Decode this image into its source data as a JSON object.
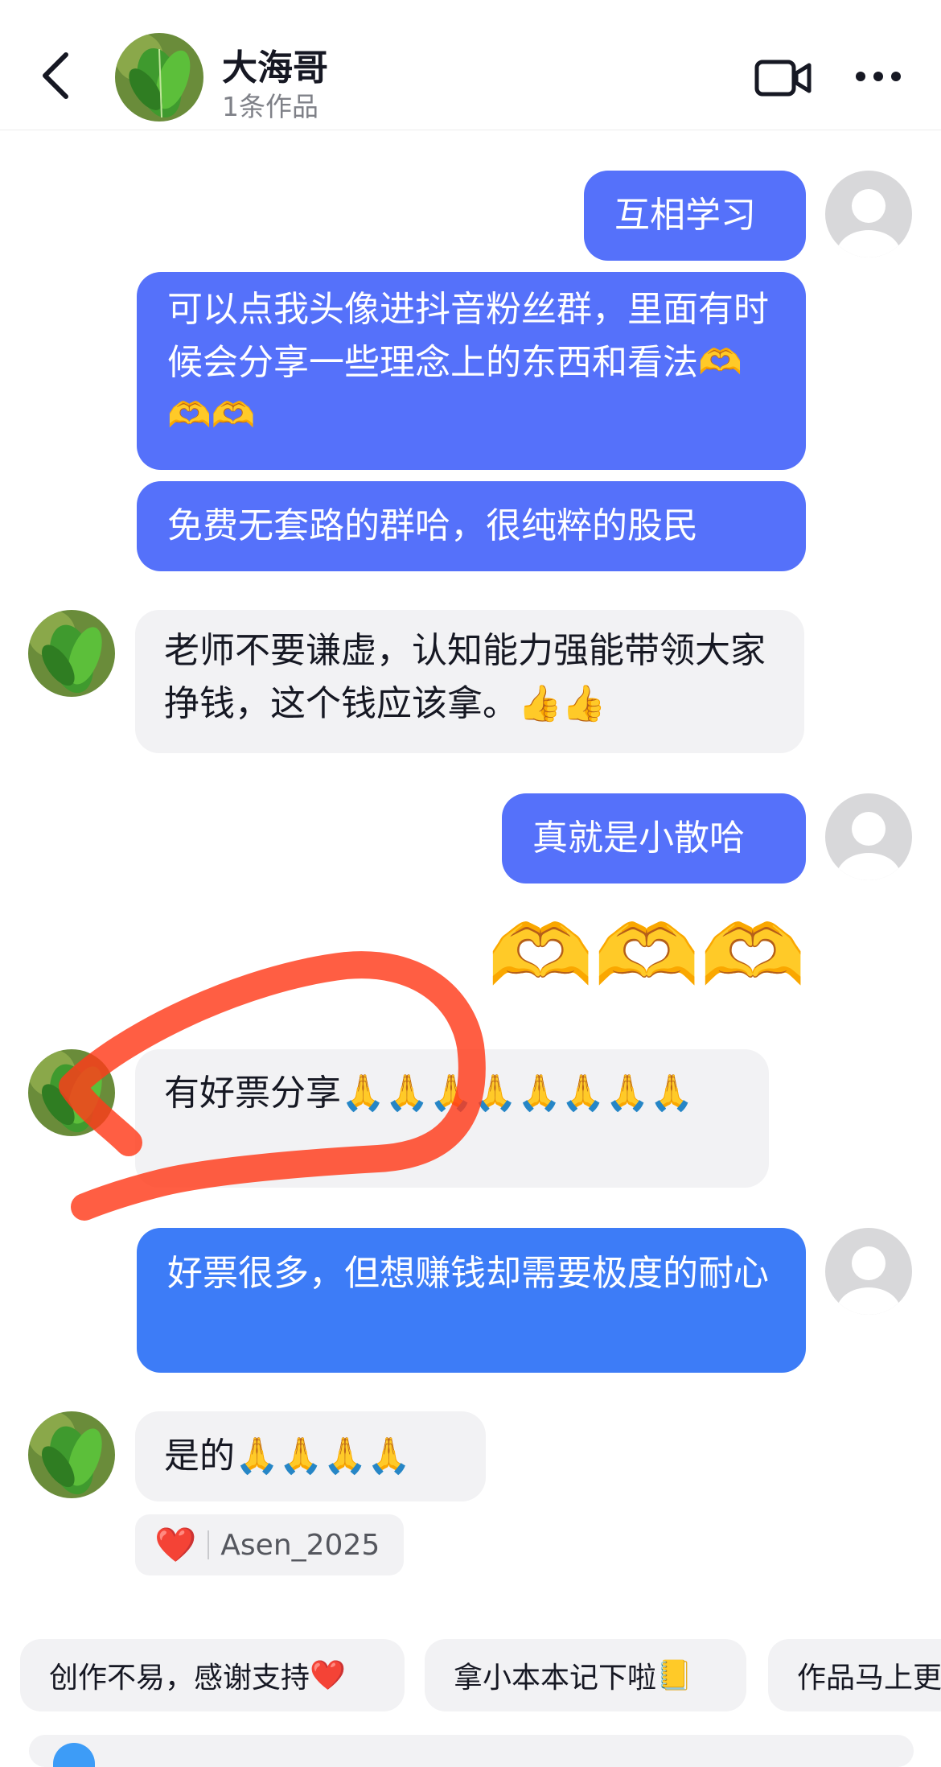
{
  "header": {
    "name": "大海哥",
    "subtitle": "1条作品",
    "back_icon": "chevron-left-icon",
    "video_icon": "video-call-icon",
    "more_icon": "more-dots-icon"
  },
  "messages": [
    {
      "side": "out",
      "text": "互相学习"
    },
    {
      "side": "out",
      "text": "可以点我头像进抖音粉丝群，里面有时候会分享一些理念上的东西和看法",
      "emoji": "🫶🫶🫶"
    },
    {
      "side": "out",
      "text": "免费无套路的群哈，很纯粹的股民"
    },
    {
      "side": "in",
      "text": "老师不要谦虚，认知能力强能带领大家挣钱，这个钱应该拿。",
      "emoji": "👍👍"
    },
    {
      "side": "out",
      "text": "真就是小散哈"
    },
    {
      "side": "out",
      "big_emoji": "🫶🫶🫶"
    },
    {
      "side": "in",
      "text": "有好票分享",
      "emoji": "🙏🙏🙏🙏🙏🙏🙏🙏"
    },
    {
      "side": "out",
      "text": "好票很多，但想赚钱却需要极度的耐心"
    },
    {
      "side": "in",
      "text": "是的",
      "emoji": "🙏🙏🙏🙏"
    }
  ],
  "reaction": {
    "emoji": "❤️",
    "user": "Asen_2025"
  },
  "quick_replies": [
    {
      "label": "创作不易，感谢支持",
      "emoji": "❤️"
    },
    {
      "label": "拿小本本记下啦",
      "emoji": "📒"
    },
    {
      "label": "作品马上更"
    }
  ],
  "colors": {
    "outgoing_bubble": "#5571fa",
    "outgoing_bubble_alt": "#3d7cf7",
    "incoming_bubble": "#f2f2f4",
    "scribble": "#ff3b1a"
  }
}
